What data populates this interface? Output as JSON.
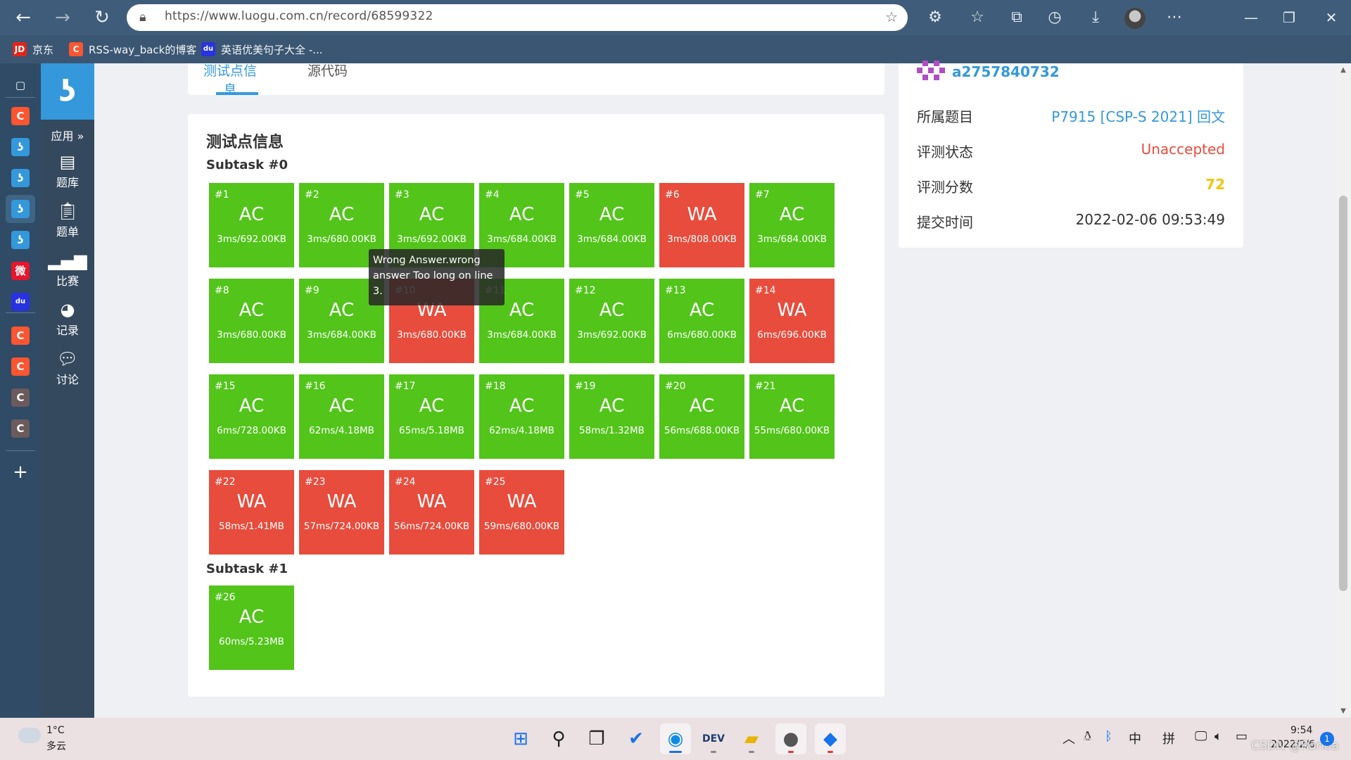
{
  "browser": {
    "url": "https://www.luogu.com.cn/record/68599322",
    "bookmarks": [
      {
        "label": "京东",
        "icon": "JD",
        "color": "#e1251b"
      },
      {
        "label": "RSS-way_back的博客",
        "icon": "C",
        "color": "#fc5531"
      },
      {
        "label": "英语优美句子大全 -...",
        "icon": "du",
        "color": "#2932e1"
      }
    ]
  },
  "vertical_tabs": [
    {
      "icon": "tab-actions-icon",
      "glyph": "▢",
      "color": "#2f4b66"
    },
    {
      "icon": "csdn-icon",
      "glyph": "C",
      "color": "#fc5531"
    },
    {
      "icon": "luogu-icon",
      "glyph": "ʖ",
      "color": "#3498db"
    },
    {
      "icon": "luogu-icon",
      "glyph": "ʖ",
      "color": "#3498db"
    },
    {
      "icon": "luogu-icon",
      "glyph": "ʖ",
      "color": "#3498db"
    },
    {
      "icon": "luogu-icon",
      "glyph": "ʖ",
      "color": "#3498db"
    },
    {
      "icon": "weibo-icon",
      "glyph": "微",
      "color": "#e6162d"
    },
    {
      "icon": "baidu-icon",
      "glyph": "du",
      "color": "#2932e1"
    },
    {
      "icon": "csdn-icon",
      "glyph": "C",
      "color": "#fc5531"
    },
    {
      "icon": "csdn-icon",
      "glyph": "C",
      "color": "#fc5531"
    },
    {
      "icon": "csdn-icon",
      "glyph": "C",
      "color": "#6b5b5b"
    },
    {
      "icon": "csdn-icon",
      "glyph": "C",
      "color": "#6b5b5b"
    }
  ],
  "sidebar": {
    "apps_label": "应用 »",
    "items": [
      {
        "label": "题库",
        "icon": "problem-list-icon"
      },
      {
        "label": "题单",
        "icon": "training-icon"
      },
      {
        "label": "比赛",
        "icon": "contest-icon"
      },
      {
        "label": "记录",
        "icon": "record-icon"
      },
      {
        "label": "讨论",
        "icon": "discuss-icon"
      }
    ]
  },
  "tabs": {
    "test_points": "测试点信息",
    "source": "源代码"
  },
  "cases_title": "测试点信息",
  "subtasks": [
    {
      "title": "Subtask #0",
      "cases": [
        {
          "id": "#1",
          "status": "AC",
          "meta": "3ms/692.00KB"
        },
        {
          "id": "#2",
          "status": "AC",
          "meta": "3ms/680.00KB"
        },
        {
          "id": "#3",
          "status": "AC",
          "meta": "3ms/692.00KB"
        },
        {
          "id": "#4",
          "status": "AC",
          "meta": "3ms/684.00KB"
        },
        {
          "id": "#5",
          "status": "AC",
          "meta": "3ms/684.00KB"
        },
        {
          "id": "#6",
          "status": "WA",
          "meta": "3ms/808.00KB"
        },
        {
          "id": "#7",
          "status": "AC",
          "meta": "3ms/684.00KB"
        },
        {
          "id": "#8",
          "status": "AC",
          "meta": "3ms/680.00KB"
        },
        {
          "id": "#9",
          "status": "AC",
          "meta": "3ms/684.00KB"
        },
        {
          "id": "#10",
          "status": "WA",
          "meta": "3ms/680.00KB"
        },
        {
          "id": "#11",
          "status": "AC",
          "meta": "3ms/684.00KB"
        },
        {
          "id": "#12",
          "status": "AC",
          "meta": "3ms/692.00KB"
        },
        {
          "id": "#13",
          "status": "AC",
          "meta": "6ms/680.00KB"
        },
        {
          "id": "#14",
          "status": "WA",
          "meta": "6ms/696.00KB"
        },
        {
          "id": "#15",
          "status": "AC",
          "meta": "6ms/728.00KB"
        },
        {
          "id": "#16",
          "status": "AC",
          "meta": "62ms/4.18MB"
        },
        {
          "id": "#17",
          "status": "AC",
          "meta": "65ms/5.18MB"
        },
        {
          "id": "#18",
          "status": "AC",
          "meta": "62ms/4.18MB"
        },
        {
          "id": "#19",
          "status": "AC",
          "meta": "58ms/1.32MB"
        },
        {
          "id": "#20",
          "status": "AC",
          "meta": "56ms/688.00KB"
        },
        {
          "id": "#21",
          "status": "AC",
          "meta": "55ms/680.00KB"
        },
        {
          "id": "#22",
          "status": "WA",
          "meta": "58ms/1.41MB"
        },
        {
          "id": "#23",
          "status": "WA",
          "meta": "57ms/724.00KB"
        },
        {
          "id": "#24",
          "status": "WA",
          "meta": "56ms/724.00KB"
        },
        {
          "id": "#25",
          "status": "WA",
          "meta": "59ms/680.00KB"
        }
      ]
    },
    {
      "title": "Subtask #1",
      "cases": [
        {
          "id": "#26",
          "status": "AC",
          "meta": "60ms/5.23MB"
        }
      ]
    }
  ],
  "tooltip": "Wrong Answer.wrong answer Too long on line 3.",
  "info": {
    "username": "a2757840732",
    "rows": [
      {
        "label": "所属题目",
        "value": "P7915 [CSP-S 2021] 回文",
        "color": "#3498db"
      },
      {
        "label": "评测状态",
        "value": "Unaccepted",
        "color": "#e74c3c"
      },
      {
        "label": "评测分数",
        "value": "72",
        "color": "#f1c40f"
      },
      {
        "label": "提交时间",
        "value": "2022-02-06 09:53:49",
        "color": "#333333"
      }
    ]
  },
  "taskbar": {
    "temp": "1°C",
    "weather": "多云",
    "time": "9:54",
    "date": "2022/2/6",
    "ime1": "中",
    "ime2": "拼",
    "notifications": "1",
    "watermark": "CSDN @Rorloa"
  }
}
